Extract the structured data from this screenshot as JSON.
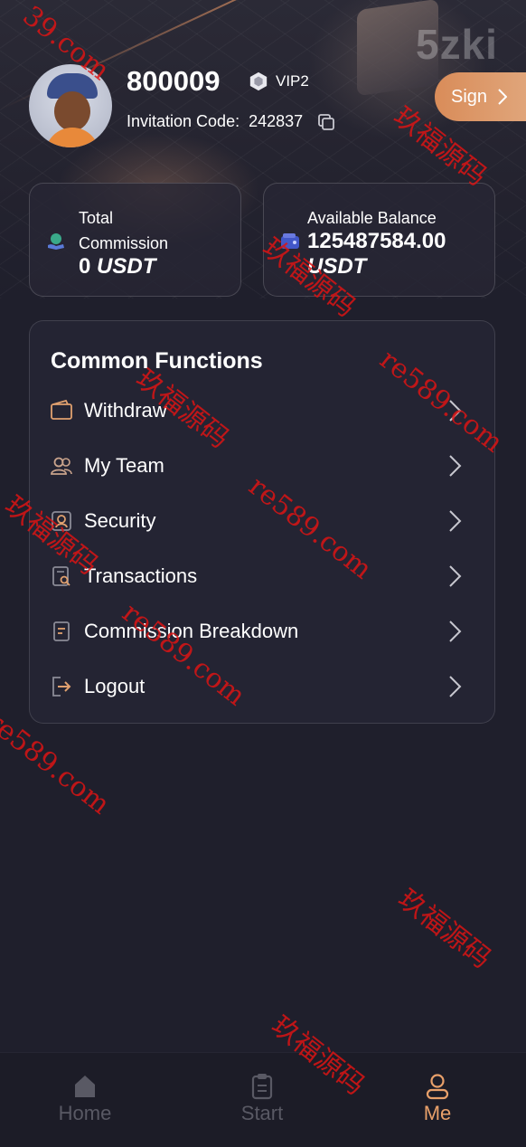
{
  "header": {
    "brand_text": "5zki",
    "user_id": "800009",
    "vip_level": "VIP2",
    "invitation_label": "Invitation Code:",
    "invitation_code": "242837",
    "sign_label": "Sign"
  },
  "stats": {
    "total_commission": {
      "label": "Total Commission",
      "label_line1": "Total",
      "label_line2": "Commission",
      "value": "0",
      "unit": "USDT"
    },
    "available_balance": {
      "label": "Available Balance",
      "value": "125487584.00",
      "unit": "USDT"
    }
  },
  "functions": {
    "title": "Common Functions",
    "items": [
      {
        "label": "Withdraw",
        "icon": "wallet-icon"
      },
      {
        "label": "My Team",
        "icon": "team-icon"
      },
      {
        "label": "Security",
        "icon": "security-icon"
      },
      {
        "label": "Transactions",
        "icon": "transactions-icon"
      },
      {
        "label": "Commission Breakdown",
        "icon": "document-icon"
      },
      {
        "label": "Logout",
        "icon": "logout-icon"
      }
    ]
  },
  "bottom_nav": {
    "tabs": [
      {
        "label": "Home",
        "icon": "home-icon",
        "active": false
      },
      {
        "label": "Start",
        "icon": "clipboard-icon",
        "active": false
      },
      {
        "label": "Me",
        "icon": "user-icon",
        "active": true
      }
    ]
  },
  "watermark": {
    "text_cn": "玖福源码",
    "text_url": "re589.com",
    "fragment_url_top": "39.com",
    "fragment_url_left": "re589.com"
  },
  "colors": {
    "background": "#1f1f2c",
    "accent": "#e0a06f",
    "panel": "#242433",
    "watermark": "#dc1414"
  }
}
